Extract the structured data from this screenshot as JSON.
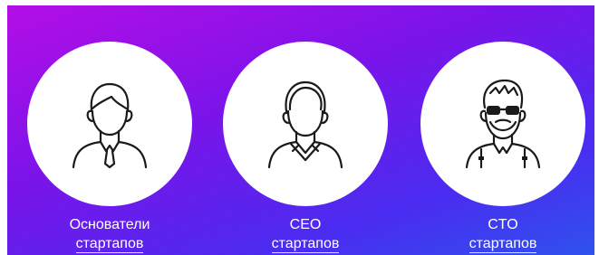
{
  "cards": [
    {
      "icon": "founder-avatar-icon",
      "line1": "Основатели",
      "line2": "стартапов"
    },
    {
      "icon": "ceo-avatar-icon",
      "line1": "CEO",
      "line2": "стартапов"
    },
    {
      "icon": "cto-avatar-icon",
      "line1": "CTO",
      "line2": "стартапов"
    }
  ],
  "colors": {
    "gradient_start": "#b40ee6",
    "gradient_end": "#2f52ee",
    "circle": "#ffffff",
    "text": "#ffffff"
  }
}
